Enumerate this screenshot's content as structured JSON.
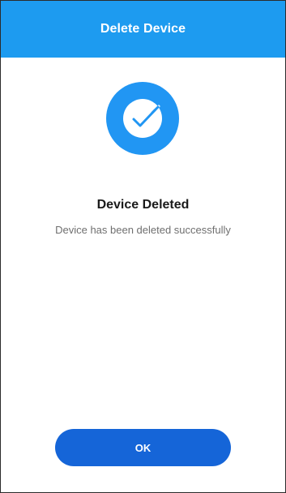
{
  "header": {
    "title": "Delete Device"
  },
  "status": {
    "icon": "check-circle-icon",
    "title": "Device Deleted",
    "message": "Device has been deleted successfully"
  },
  "actions": {
    "ok_label": "OK"
  },
  "colors": {
    "header_background": "#1d9bf0",
    "icon_circle": "#2196f3",
    "button_background": "#1565d8"
  }
}
